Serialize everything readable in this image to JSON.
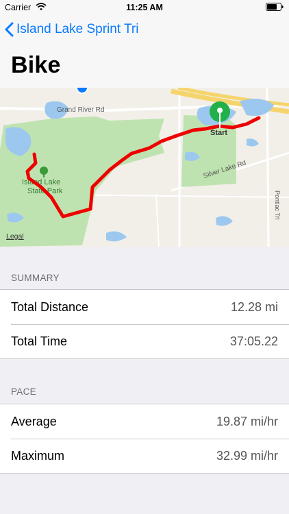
{
  "status_bar": {
    "carrier": "Carrier",
    "time": "11:25 AM"
  },
  "nav": {
    "back_label": "Island Lake Sprint Tri",
    "title": "Bike"
  },
  "map": {
    "labels": {
      "grand_river": "Grand River Rd",
      "silver_lake": "Silver Lake Rd",
      "park_line1": "Island Lake",
      "park_line2": "State Park",
      "pontiac": "Pontiac Trl",
      "start": "Start"
    },
    "legal": "Legal",
    "route_color": "#ee0000",
    "pin_color": "#22b04b"
  },
  "summary": {
    "header": "SUMMARY",
    "rows": [
      {
        "label": "Total Distance",
        "value": "12.28 mi"
      },
      {
        "label": "Total Time",
        "value": "37:05.22"
      }
    ]
  },
  "pace": {
    "header": "PACE",
    "rows": [
      {
        "label": "Average",
        "value": "19.87 mi/hr"
      },
      {
        "label": "Maximum",
        "value": "32.99 mi/hr"
      }
    ]
  }
}
